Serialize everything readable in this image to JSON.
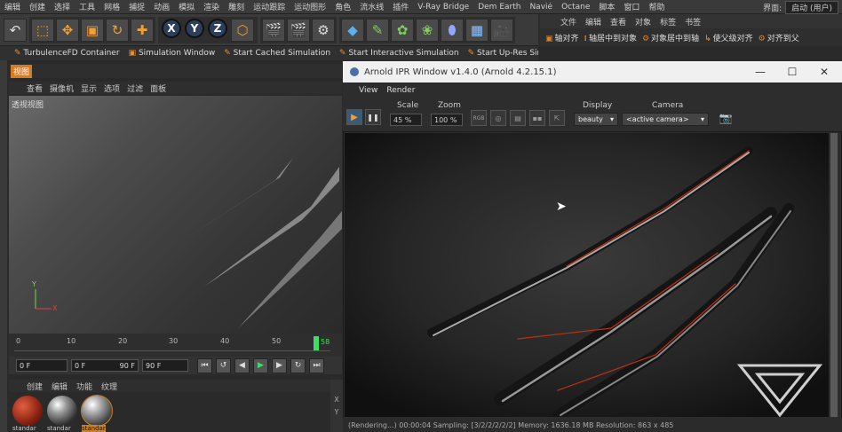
{
  "menubar": {
    "items": [
      "编辑",
      "创建",
      "选择",
      "工具",
      "网格",
      "捕捉",
      "动画",
      "模拟",
      "渲染",
      "雕刻",
      "运动跟踪",
      "运动图形",
      "角色",
      "流水线",
      "插件",
      "V-Ray Bridge",
      "Dem Earth",
      "Naviė",
      "Octane",
      "脚本",
      "窗口",
      "帮助"
    ],
    "layout_label": "界面:",
    "layout_value": "启动 (用户)"
  },
  "toolbar": {
    "x_label": "X",
    "y_label": "Y",
    "z_label": "Z"
  },
  "object_panel": {
    "menu": [
      "文件",
      "编辑",
      "查看",
      "对象",
      "标签",
      "书签"
    ],
    "tools": [
      "轴对齐",
      "轴居中到对象",
      "对象居中到轴",
      "使父级对齐",
      "对齐到父"
    ]
  },
  "tabbar": {
    "tabs": [
      "TurbulenceFD Container",
      "Simulation Window",
      "Start Cached Simulation",
      "Start Interactive Simulation",
      "Start Up-Res Simul"
    ]
  },
  "viewport": {
    "tag": "视图",
    "menu": [
      "查看",
      "摄像机",
      "显示",
      "选项",
      "过滤",
      "面板"
    ],
    "label": "透视视图"
  },
  "timeline": {
    "ticks": [
      "0",
      "10",
      "20",
      "30",
      "40",
      "50"
    ],
    "current_frame": "58",
    "start_field": "0 F",
    "range_start": "0 F",
    "range_end": "90 F",
    "end_field": "90 F"
  },
  "materials": {
    "menu": [
      "创建",
      "编辑",
      "功能",
      "纹理"
    ],
    "items": [
      "standar",
      "standar",
      "standar"
    ]
  },
  "side_axes": [
    "X",
    "Y"
  ],
  "ipr_window": {
    "title": "Arnold IPR Window v1.4.0 (Arnold 4.2.15.1)",
    "menu": [
      "View",
      "Render"
    ],
    "scale_label": "Scale",
    "scale_value": "45 %",
    "zoom_label": "Zoom",
    "zoom_value": "100 %",
    "rgb_label": "RGB",
    "display_label": "Display",
    "display_value": "beauty",
    "camera_label": "Camera",
    "camera_value": "<active camera>",
    "status": "(Rendering...)  00:00:04  Sampling: [3/2/2/2/2/2]  Memory: 1636.18 MB  Resolution: 863 x 485"
  }
}
